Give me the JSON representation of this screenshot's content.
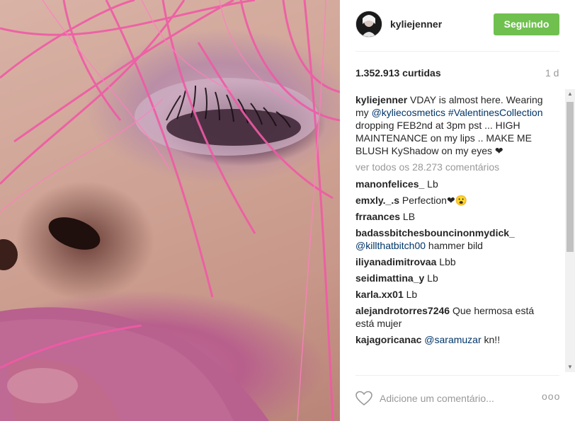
{
  "post": {
    "username": "kyliejenner",
    "follow_label": "Seguindo",
    "likes": "1.352.913 curtidas",
    "time": "1 d",
    "caption_user": "kyliejenner",
    "caption_p1": " VDAY is almost here. Wearing my ",
    "caption_mention": "@kyliecosmetics",
    "caption_p2": " ",
    "caption_hashtag": "#ValentinesCollection",
    "caption_p3": " dropping FEB2nd at 3pm pst ... HIGH MAINTENANCE on my lips .. MAKE ME BLUSH KyShadow on my eyes ",
    "caption_emoji": "❤",
    "view_all": "ver todos os 28.273 comentários",
    "more_icon": "ooo",
    "comment_placeholder": "Adicione um comentário..."
  },
  "comments": [
    {
      "user": "manonfelices_",
      "text": " Lb"
    },
    {
      "user": "emxly._.s",
      "text": " Perfection❤😮"
    },
    {
      "user": "frraances",
      "text": " LB"
    },
    {
      "user": "badassbitchesbouncinonmydick_",
      "mention": " @killthatbitch00",
      "text": " hammer bild"
    },
    {
      "user": "iliyanadimitrovaa",
      "text": " Lbb"
    },
    {
      "user": "seidimattina_y",
      "text": " Lb"
    },
    {
      "user": "karla.xx01",
      "text": " Lb"
    },
    {
      "user": "alejandrotorres7246",
      "text": " Que hermosa está está mujer"
    },
    {
      "user": "kajagoricanac",
      "mention": " @saramuzar",
      "text": " kn!!"
    }
  ],
  "colors": {
    "follow_bg": "#70c050",
    "link": "#003569",
    "muted": "#999999"
  },
  "icons": [
    "heart-icon",
    "more-options-icon",
    "scroll-up-icon",
    "scroll-down-icon"
  ]
}
